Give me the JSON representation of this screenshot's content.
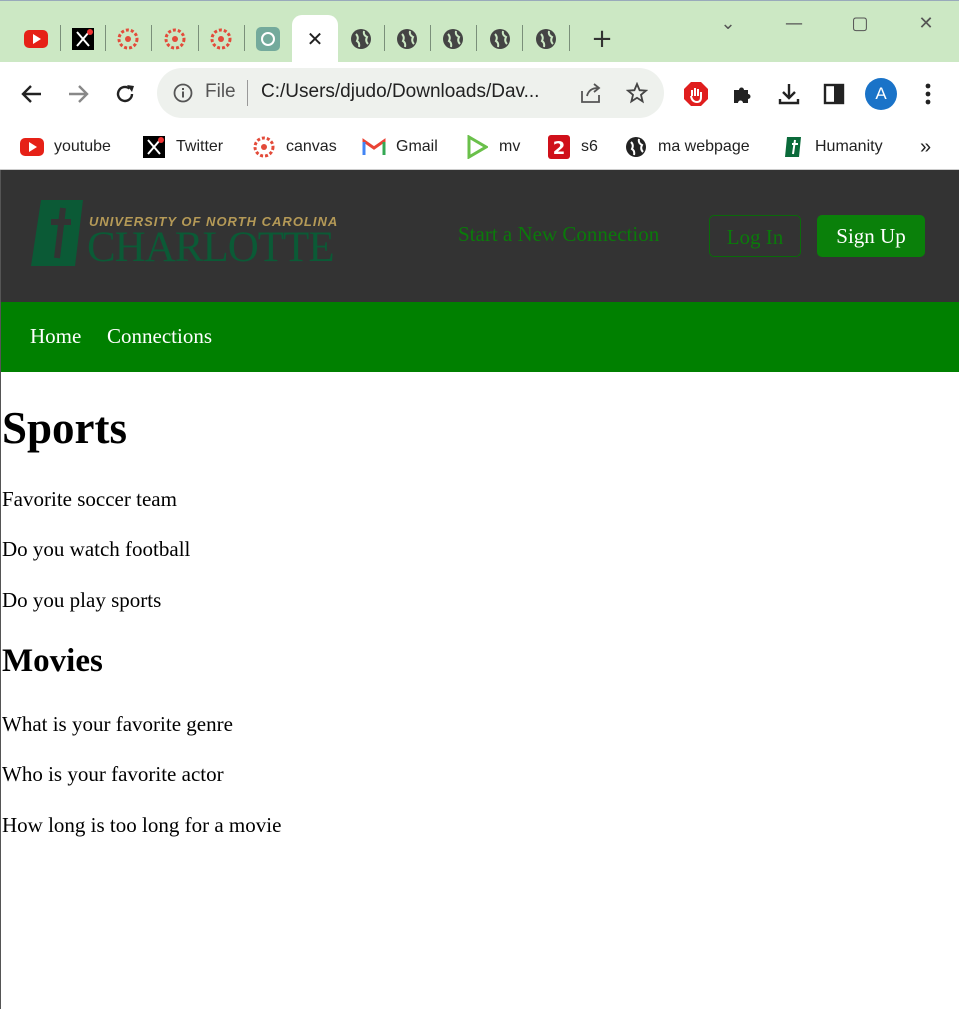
{
  "browser": {
    "tabs": [
      {
        "icon": "youtube-icon"
      },
      {
        "icon": "x-twitter-icon"
      },
      {
        "icon": "canvas-icon"
      },
      {
        "icon": "canvas-icon"
      },
      {
        "icon": "canvas-icon"
      },
      {
        "icon": "chatgpt-icon"
      },
      {
        "icon": "close-icon",
        "active": true
      },
      {
        "icon": "globe-icon"
      },
      {
        "icon": "globe-icon"
      },
      {
        "icon": "globe-icon"
      },
      {
        "icon": "globe-icon"
      },
      {
        "icon": "globe-icon"
      }
    ],
    "address": {
      "scheme_label": "File",
      "url": "C:/Users/djudo/Downloads/Dav..."
    },
    "profile_initial": "A",
    "bookmarks": [
      {
        "label": "youtube",
        "icon": "youtube-icon"
      },
      {
        "label": "Twitter",
        "icon": "x-twitter-icon"
      },
      {
        "label": "canvas",
        "icon": "canvas-icon"
      },
      {
        "label": "Gmail",
        "icon": "gmail-icon"
      },
      {
        "label": "mv",
        "icon": "play-icon"
      },
      {
        "label": "s6",
        "icon": "s6-icon"
      },
      {
        "label": "ma webpage",
        "icon": "globe-icon"
      },
      {
        "label": "Humanity",
        "icon": "humanity-icon"
      }
    ],
    "bookmarks_overflow": "»"
  },
  "site": {
    "logo": {
      "top": "UNIVERSITY OF NORTH CAROLINA",
      "bottom": "CHARLOTTE"
    },
    "header_link": "Start a New Connection",
    "login_label": "Log In",
    "signup_label": "Sign Up",
    "nav": [
      "Home",
      "Connections"
    ],
    "colors": {
      "header_bg": "#333333",
      "nav_bg": "#008000",
      "accent": "#0a800a"
    }
  },
  "content": {
    "sections": [
      {
        "title": "Sports",
        "items": [
          "Favorite soccer team",
          "Do you watch football",
          "Do you play sports"
        ]
      },
      {
        "title": "Movies",
        "items": [
          "What is your favorite genre",
          "Who is your favorite actor",
          "How long is too long for a movie"
        ]
      }
    ]
  }
}
